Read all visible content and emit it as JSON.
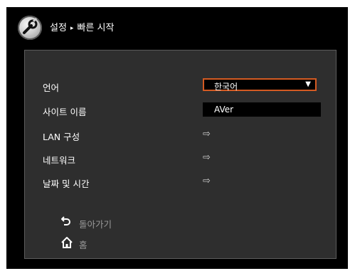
{
  "header": {
    "icon": "wrench-icon",
    "breadcrumb_root": "설정",
    "breadcrumb_separator": "▸",
    "breadcrumb_current": "빠른 시작"
  },
  "menu": {
    "language": {
      "label": "언어",
      "value": "한국어",
      "dropdown_arrow": "▼"
    },
    "site_name": {
      "label": "사이트 이름",
      "value": "AVer"
    },
    "lan_settings": {
      "label": "LAN 구성",
      "arrow": "⇨"
    },
    "network": {
      "label": "네트워크",
      "arrow": "⇨"
    },
    "date_time": {
      "label": "날짜 및 시간",
      "arrow": "⇨"
    }
  },
  "nav": {
    "back": {
      "label": "돌아가기",
      "icon": "back-arrow-icon"
    },
    "home": {
      "label": "홈",
      "icon": "home-icon"
    }
  },
  "colors": {
    "background": "#000000",
    "panel": "#2e2e2e",
    "accent": "#d45a22"
  }
}
